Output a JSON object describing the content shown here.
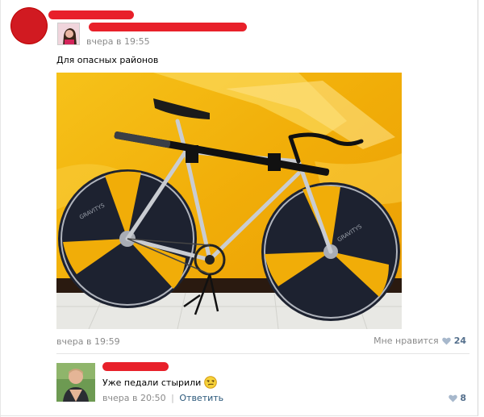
{
  "post": {
    "time": "вчера в 19:55",
    "text": "Для опасных районов"
  },
  "photo": {
    "colors": {
      "wall": "#f3b50d",
      "floor": "#e8e8e4",
      "baseboard": "#2a1a10"
    },
    "text_on_wheels": [
      "GRAVITYS",
      "GRAVITYS"
    ]
  },
  "post_footer": {
    "time": "вчера в 19:59",
    "like_label": "Мне нравится",
    "like_count": "24"
  },
  "comment": {
    "text": "Уже педали стырили",
    "time": "вчера в 20:50",
    "separator": "|",
    "reply_label": "Ответить",
    "like_count": "8"
  },
  "colors": {
    "redaction": "#e8202a",
    "link": "#2b587a",
    "meta": "#8a8a8a"
  }
}
